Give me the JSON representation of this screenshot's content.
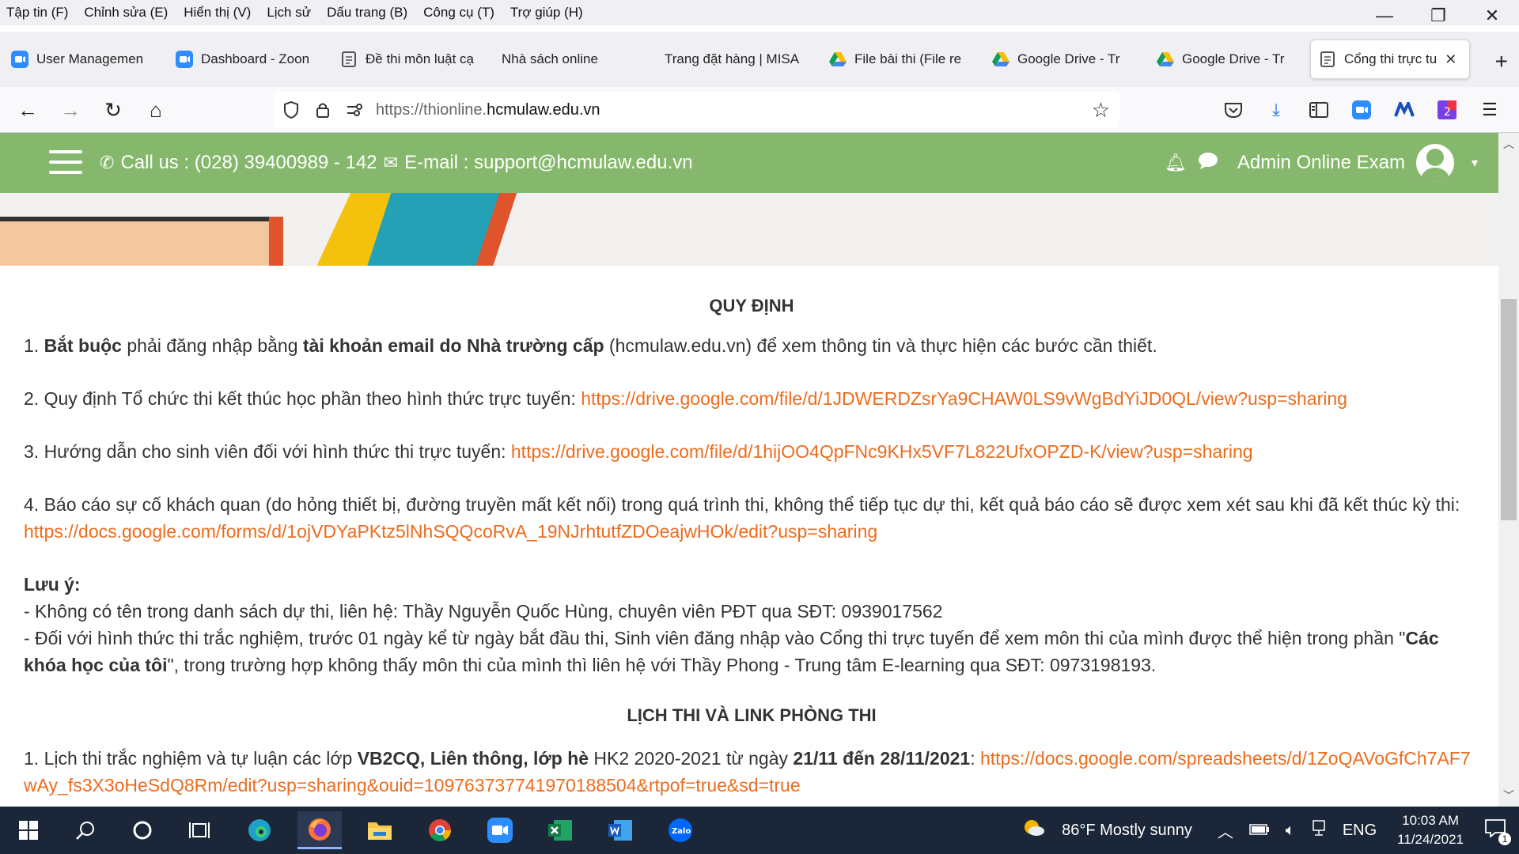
{
  "menu": [
    "Tập tin (F)",
    "Chỉnh sửa (E)",
    "Hiển thị (V)",
    "Lịch sử",
    "Dấu trang (B)",
    "Công cụ (T)",
    "Trợ giúp (H)"
  ],
  "window_controls": {
    "minimize": "—",
    "restore": "❐",
    "close": "✕"
  },
  "tabs": [
    {
      "label": "User Managemen",
      "icon": "zoom-icon"
    },
    {
      "label": "Dashboard - Zoon",
      "icon": "zoom-icon"
    },
    {
      "label": "Đề thi môn luật cạ",
      "icon": "moodle-icon"
    },
    {
      "label": "Nhà sách online",
      "icon": ""
    },
    {
      "label": "Trang đặt hàng | MISA",
      "icon": ""
    },
    {
      "label": "File bài thi (File re",
      "icon": "google-drive-icon"
    },
    {
      "label": "Google Drive - Tr",
      "icon": "google-drive-icon"
    },
    {
      "label": "Google Drive - Tr",
      "icon": "google-drive-icon"
    },
    {
      "label": "Cổng thi trực tu",
      "icon": "moodle-icon",
      "active": true
    }
  ],
  "new_tab": "+",
  "url": {
    "prefix": "https://thionline.",
    "domain": "hcmulaw.edu.vn"
  },
  "header": {
    "call_label": "Call us : (028) 39400989 - 142",
    "email_label": "E-mail : support@hcmulaw.edu.vn",
    "user_name": "Admin Online Exam",
    "caret": "▾"
  },
  "content": {
    "title1": "QUY ĐỊNH",
    "p1": {
      "n": "1. ",
      "b1": "Bắt buộc",
      "t1": " phải đăng nhập bằng ",
      "b2": "tài khoản email do Nhà trường cấp",
      "t2": " (hcmulaw.edu.vn) để xem thông tin và thực hiện các bước cần thiết."
    },
    "p2": {
      "t": "2. Quy định Tổ chức thi kết thúc học phần theo hình thức trực tuyến: ",
      "link": "https://drive.google.com/file/d/1JDWERDZsrYa9CHAW0LS9vWgBdYiJD0QL/view?usp=sharing"
    },
    "p3": {
      "t": "3. Hướng dẫn cho sinh viên đối với hình thức thi trực tuyến: ",
      "link": "https://drive.google.com/file/d/1hijOO4QpFNc9KHx5VF7L822UfxOPZD-K/view?usp=sharing"
    },
    "p4": {
      "t": "4. Báo cáo sự cố khách quan (do hỏng thiết bị, đường truyền mất kết nối) trong quá trình thi, không thể tiếp tục dự thi, kết quả báo cáo sẽ được xem xét sau khi đã kết thúc kỳ thi: ",
      "link": "https://docs.google.com/forms/d/1ojVDYaPKtz5lNhSQQcoRvA_19NJrhtutfZDOeajwHOk/edit?usp=sharing"
    },
    "note_title": "Lưu ý:",
    "note1": "- Không có tên trong danh sách dự thi, liên hệ: Thầy Nguyễn Quốc Hùng, chuyên viên PĐT qua SĐT: 0939017562",
    "note2": {
      "t1": "- Đối với hình thức thi trắc nghiệm, trước 01 ngày kể từ ngày bắt đầu thi, Sinh viên đăng nhập vào Cổng thi trực tuyến để xem môn thi của mình được thể hiện trong phần \"",
      "b": "Các khóa học của tôi",
      "t2": "\", trong trường hợp không thấy môn thi của mình thì liên hệ với Thầy Phong - Trung tâm E-learning qua SĐT: 0973198193."
    },
    "title2": "LỊCH THI VÀ LINK PHÒNG THI",
    "p5": {
      "t1": "1. Lịch thi trắc nghiệm và tự luận các lớp ",
      "b1": "VB2CQ, Liên thông, lớp hè",
      "t2": " HK2 2020-2021 từ ngày ",
      "b2": "21/11 đến 28/11/2021",
      "t3": ": ",
      "link": "https://docs.google.com/spreadsheets/d/1ZoQAVoGfCh7AF7wAy_fs3X3oHeSdQ8Rm/edit?usp=sharing&ouid=109763737741970188504&rtpof=true&sd=true"
    }
  },
  "taskbar": {
    "weather": "86°F  Mostly sunny",
    "lang": "ENG",
    "time": "10:03 AM",
    "date": "11/24/2021",
    "notif": "1"
  },
  "colors": {
    "header_green": "#85b86c",
    "link_orange": "#ec6c1e",
    "taskbar": "#1b2638"
  }
}
